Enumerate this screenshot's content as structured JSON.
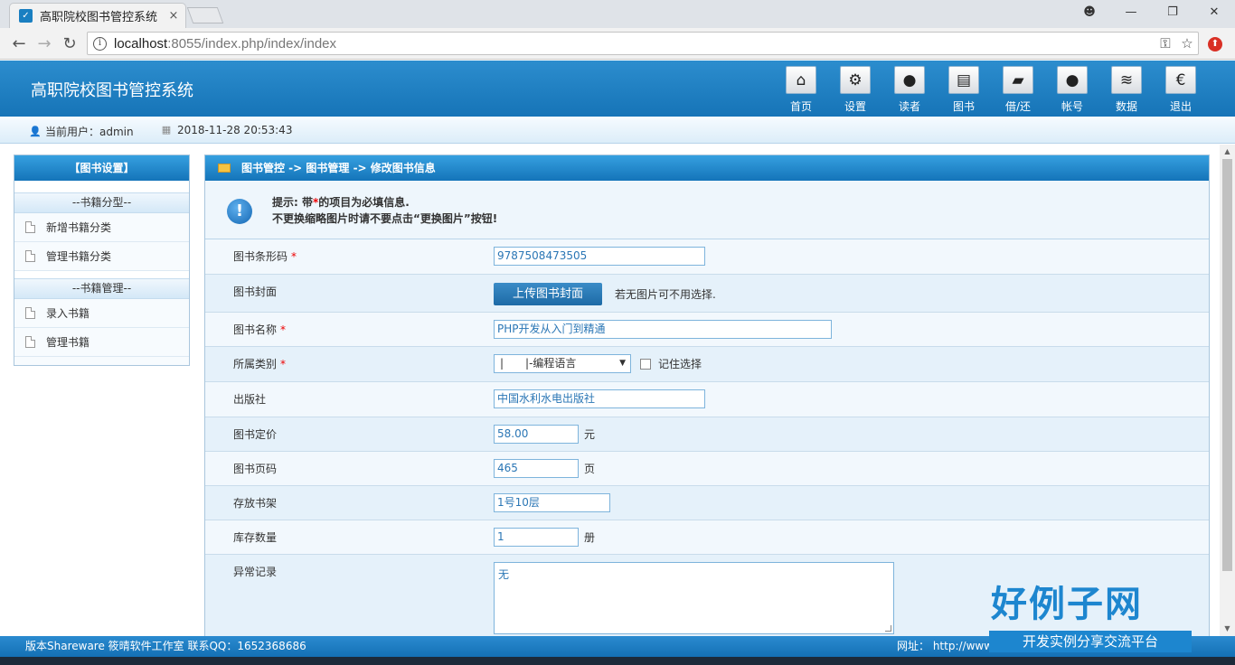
{
  "browser": {
    "tab_title": "高职院校图书管控系统",
    "tab_close": "×",
    "url_host": "localhost",
    "url_rest": ":8055/index.php/index/index",
    "controls": {
      "profile": "☻",
      "minimize": "—",
      "restore": "❐",
      "close": "✕"
    },
    "nav": {
      "back": "←",
      "forward": "→",
      "reload": "↻"
    },
    "url_icons": {
      "key": "⚿",
      "star": "☆"
    }
  },
  "app": {
    "title": "高职院校图书管控系统",
    "topnav": [
      {
        "label": "首页",
        "icon": "home-icon",
        "glyph": "⌂"
      },
      {
        "label": "设置",
        "icon": "gears-icon",
        "glyph": "⚙"
      },
      {
        "label": "读者",
        "icon": "users-icon",
        "glyph": "●"
      },
      {
        "label": "图书",
        "icon": "book-icon",
        "glyph": "▤"
      },
      {
        "label": "借/还",
        "icon": "folder-icon",
        "glyph": "▰"
      },
      {
        "label": "帐号",
        "icon": "user-icon",
        "glyph": "●"
      },
      {
        "label": "数据",
        "icon": "database-icon",
        "glyph": "≋"
      },
      {
        "label": "退出",
        "icon": "euro-icon",
        "glyph": "€"
      }
    ]
  },
  "userbar": {
    "user_label": "当前用户：",
    "user_name": "admin",
    "datetime": "2018-11-28 20:53:43"
  },
  "sidebar": {
    "title": "【图书设置】",
    "groups": [
      {
        "title": "--书籍分型--",
        "items": [
          "新增书籍分类",
          "管理书籍分类"
        ]
      },
      {
        "title": "--书籍管理--",
        "items": [
          "录入书籍",
          "管理书籍"
        ]
      }
    ]
  },
  "main": {
    "breadcrumb": "图书管控 -> 图书管理 -> 修改图书信息",
    "tip_line1_a": "提示: 带",
    "tip_star": "*",
    "tip_line1_b": "的项目为必填信息.",
    "tip_line2": "不更换缩略图片时请不要点击“更换图片”按钮!",
    "fields": {
      "barcode": {
        "label": "图书条形码",
        "required": "*",
        "value": "9787508473505"
      },
      "cover": {
        "label": "图书封面",
        "button": "上传图书封面",
        "hint": "若无图片可不用选择."
      },
      "name": {
        "label": "图书名称",
        "required": "*",
        "value": "PHP开发从入门到精通"
      },
      "category": {
        "label": "所属类别",
        "required": "*",
        "selected": "|　　|-编程语言",
        "remember": "记住选择"
      },
      "publisher": {
        "label": "出版社",
        "value": "中国水利水电出版社"
      },
      "price": {
        "label": "图书定价",
        "value": "58.00",
        "unit": "元"
      },
      "pages": {
        "label": "图书页码",
        "value": "465",
        "unit": "页"
      },
      "shelf": {
        "label": "存放书架",
        "value": "1号10层"
      },
      "stock": {
        "label": "库存数量",
        "value": "1",
        "unit": "册"
      },
      "remark": {
        "label": "异常记录",
        "value": "无"
      }
    }
  },
  "footer": {
    "left": "版本Shareware  筱晴软件工作室  联系QQ：1652368686",
    "right": "网址： http://www.                                              .com"
  },
  "watermark": {
    "big": "好例子网",
    "small": "开发实例分享交流平台"
  }
}
